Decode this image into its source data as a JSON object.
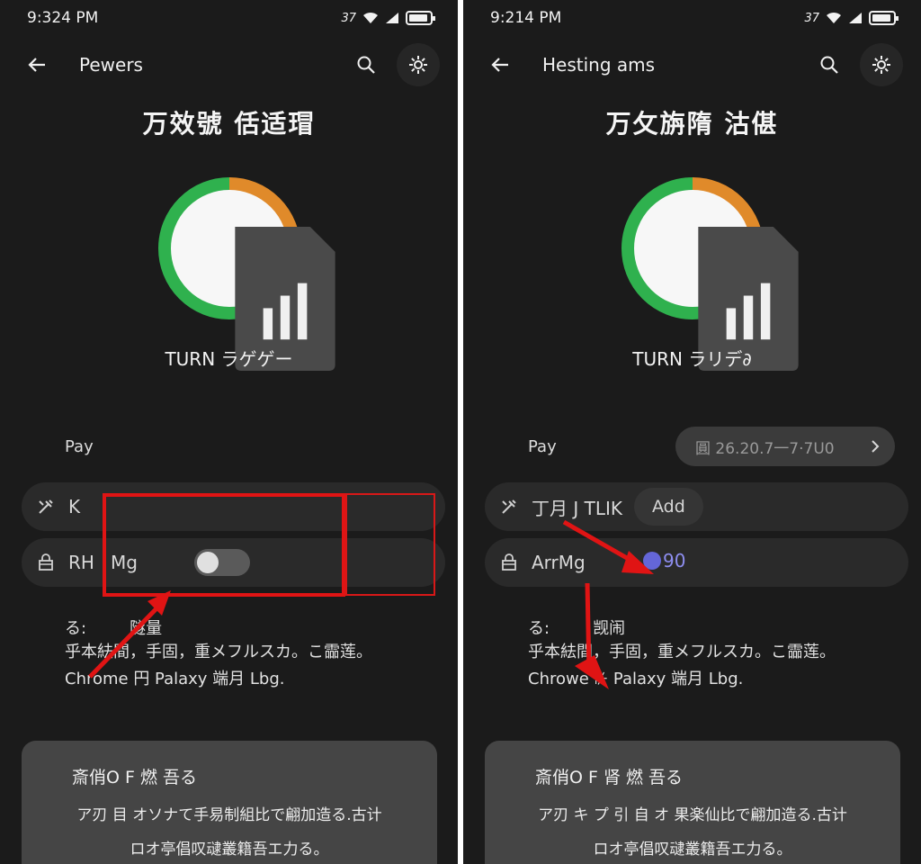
{
  "left": {
    "status": {
      "time": "9:324 PM",
      "indicator": "37"
    },
    "app_bar": {
      "title": "Pewers"
    },
    "heading": "万效號 佸适瑁",
    "ring": {
      "label": "TURN ラゲゲー",
      "green_fraction": 0.75,
      "orange_fraction": 0.25
    },
    "pay": {
      "label": "Pay"
    },
    "row1": {
      "icon": "tools-icon",
      "label": "K"
    },
    "row2": {
      "icon": "lock-icon",
      "label": "RH",
      "sub": "Mg",
      "toggle_on": false
    },
    "info": {
      "line1_a": "る:",
      "line1_b": "隧量",
      "line2": "乎本紶間，手固，重メフルスカ。こ霝莲。",
      "line3": "Chrome 円 Palaxy 端月 Lbg."
    },
    "card": {
      "title": "斎俏O F 燃 吾る",
      "body1": "ア刃 目 オソナて手易制組比で翩加造る.古计",
      "body2": "ロオ亭倡叹叇叢籍吾エ力る。"
    }
  },
  "right": {
    "status": {
      "time": "9:214 PM",
      "indicator": "37"
    },
    "app_bar": {
      "title": "Hesting ams"
    },
    "heading": "万攵旃隋 沽偡",
    "ring": {
      "label": "TURN ラリデ∂",
      "green_fraction": 0.75,
      "orange_fraction": 0.25
    },
    "pay": {
      "label": "Pay",
      "pill_text": "圓 26.20.7一7·7U0"
    },
    "row1": {
      "icon": "tools-icon",
      "label": "丁月 J TLIK",
      "chip": "Add"
    },
    "row2": {
      "icon": "lock-icon",
      "label": "ArrMg",
      "value": "90"
    },
    "info": {
      "line1_a": "る:",
      "line1_b": "觊闹",
      "line2": "乎本紶間，手固，重メフルスカ。こ霝莲。",
      "line3": "Chrowe ⊬ Palaxy 端月 Lbg."
    },
    "card": {
      "title": "斎俏O F 肾 燃 吾る",
      "body1": "ア刃 キ プ 引 自 オ 果楽仙比で翩加造る.古计",
      "body2": "ロオ亭倡叹叇叢籍吾エ力る。"
    }
  },
  "colors": {
    "background": "#1b1b1b",
    "ring_green": "#2fb14e",
    "ring_orange": "#e08a2a",
    "annotation_red": "#e01414",
    "accent_purple": "#6466d8"
  }
}
